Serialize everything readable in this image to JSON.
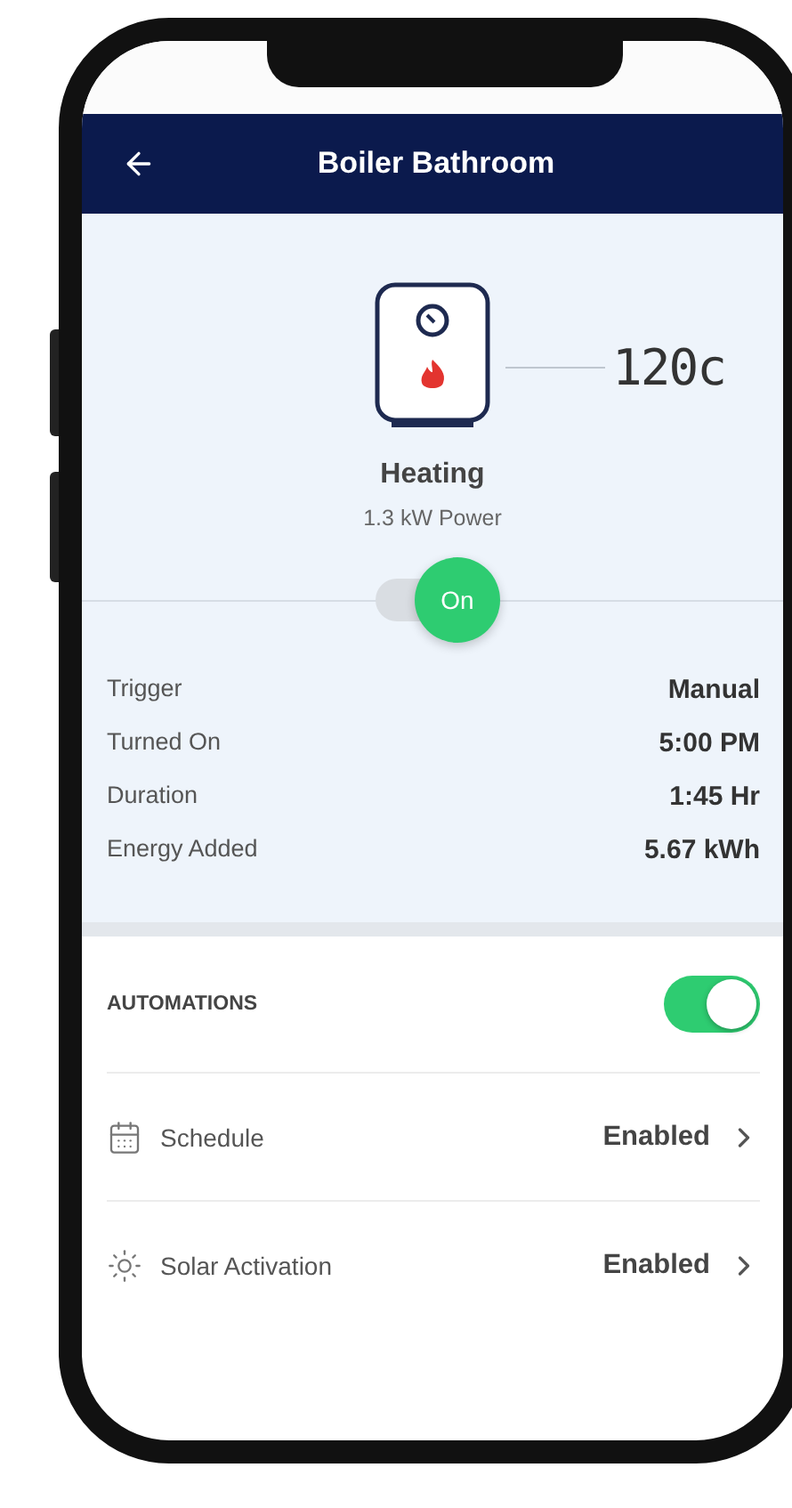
{
  "header": {
    "title": "Boiler Bathroom"
  },
  "device": {
    "temperature": "120c",
    "status": "Heating",
    "power": "1.3 kW Power"
  },
  "power_toggle": {
    "label": "On",
    "on": true
  },
  "details": [
    {
      "label": "Trigger",
      "value": "Manual"
    },
    {
      "label": "Turned On",
      "value": "5:00 PM"
    },
    {
      "label": "Duration",
      "value": "1:45 Hr"
    },
    {
      "label": "Energy Added",
      "value": "5.67 kWh"
    }
  ],
  "automations": {
    "title": "AUTOMATIONS",
    "on": true,
    "items": [
      {
        "kind": "calendar",
        "label": "Schedule",
        "value": "Enabled"
      },
      {
        "kind": "sun",
        "label": "Solar Activation",
        "value": "Enabled"
      }
    ]
  }
}
